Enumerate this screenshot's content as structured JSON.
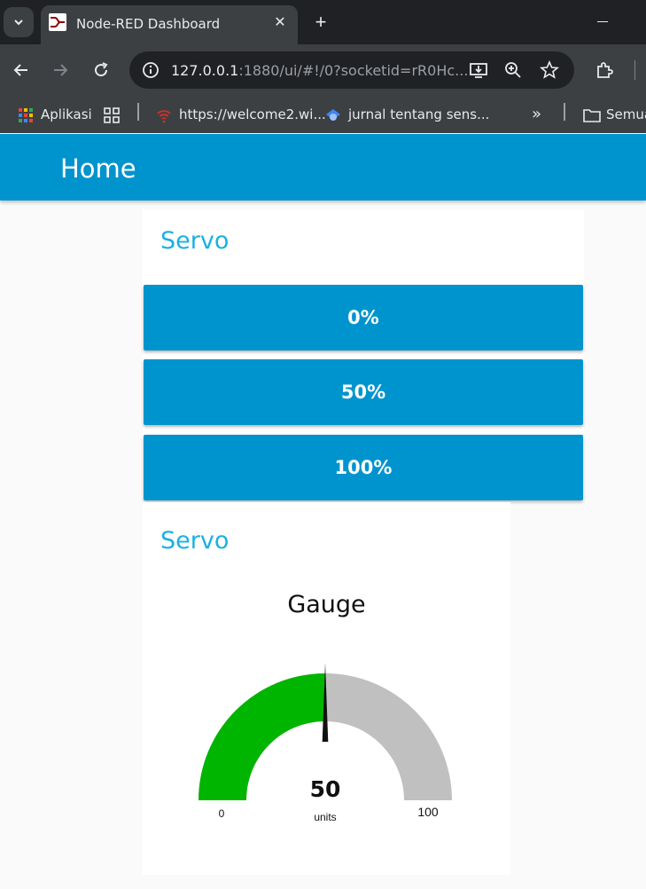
{
  "browser": {
    "tab_title": "Node-RED Dashboard",
    "url_host": "127.0.0.1",
    "url_rest": ":1880/ui/#!/0?socketid=rR0Hc...",
    "bookmarks": [
      {
        "label": "Aplikasi"
      },
      {
        "label": "https://welcome2.wi..."
      },
      {
        "label": "jurnal tentang sens..."
      },
      {
        "label": "Semua"
      }
    ]
  },
  "dashboard": {
    "page_title": "Home",
    "group1_title": "Servo",
    "buttons": [
      "0%",
      "50%",
      "100%"
    ],
    "group2_title": "Servo"
  },
  "gauge": {
    "title": "Gauge",
    "value": "50",
    "units": "units",
    "min_label": "0",
    "max_label": "100",
    "min": 0,
    "max": 100,
    "current": 50,
    "fill_color": "#00b500",
    "bg_color": "#c0c0c0"
  },
  "colors": {
    "header": "#0094ce",
    "accent_text": "#1bb0e3"
  }
}
